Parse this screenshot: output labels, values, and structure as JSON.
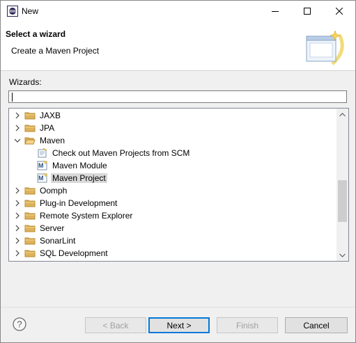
{
  "window": {
    "title": "New"
  },
  "header": {
    "title": "Select a wizard",
    "subtitle": "Create a Maven Project"
  },
  "wizards": {
    "label": "Wizards:",
    "filter_value": "",
    "items": [
      {
        "label": "JAXB",
        "type": "folder",
        "expanded": false,
        "level": 0
      },
      {
        "label": "JPA",
        "type": "folder",
        "expanded": false,
        "level": 0
      },
      {
        "label": "Maven",
        "type": "folder",
        "expanded": true,
        "level": 0
      },
      {
        "label": "Check out Maven Projects from SCM",
        "type": "scm-wizard",
        "level": 1
      },
      {
        "label": "Maven Module",
        "type": "maven-wizard",
        "level": 1
      },
      {
        "label": "Maven Project",
        "type": "maven-wizard",
        "level": 1,
        "selected": true
      },
      {
        "label": "Oomph",
        "type": "folder",
        "expanded": false,
        "level": 0
      },
      {
        "label": "Plug-in Development",
        "type": "folder",
        "expanded": false,
        "level": 0
      },
      {
        "label": "Remote System Explorer",
        "type": "folder",
        "expanded": false,
        "level": 0
      },
      {
        "label": "Server",
        "type": "folder",
        "expanded": false,
        "level": 0
      },
      {
        "label": "SonarLint",
        "type": "folder",
        "expanded": false,
        "level": 0
      },
      {
        "label": "SQL Development",
        "type": "folder",
        "expanded": false,
        "level": 0
      }
    ]
  },
  "buttons": {
    "back": "< Back",
    "next": "Next >",
    "finish": "Finish",
    "cancel": "Cancel"
  },
  "colors": {
    "folder": "#dcb35c",
    "folder_dark": "#b8892f",
    "selection": "#d9d9d9",
    "default_button_border": "#0078d7"
  }
}
